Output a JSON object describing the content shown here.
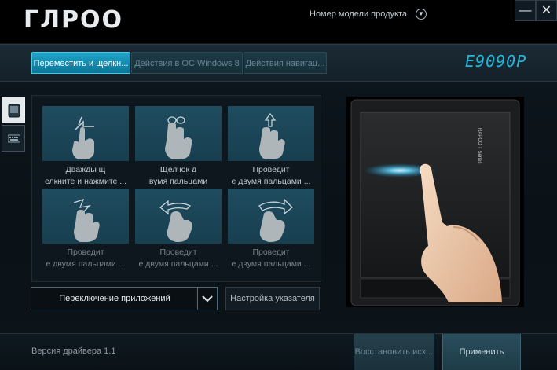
{
  "app": {
    "logo": "ГЛPOO",
    "model_label": "Номер модели продукта",
    "window_buttons": {
      "minimize": "—",
      "close": "✕"
    },
    "product_name": "E9090P"
  },
  "tabs": [
    {
      "label": "Переместить и щелкн...",
      "active": true
    },
    {
      "label": "Действия в ОС Windows 8",
      "active": false
    },
    {
      "label": "Действия навигац...",
      "active": false
    }
  ],
  "side_icons": [
    {
      "icon": "touchpad-icon",
      "active": true
    },
    {
      "icon": "keyboard-icon",
      "active": false
    }
  ],
  "gestures": [
    {
      "line1": "Дважды щ",
      "line2": "елкните и нажмите ...",
      "icon": "double-tap-hold-gesture-icon",
      "enabled": true
    },
    {
      "line1": "Щелчок д",
      "line2": "вумя пальцами",
      "icon": "two-finger-tap-gesture-icon",
      "enabled": true
    },
    {
      "line1": "Проведит",
      "line2": "е двумя пальцами ...",
      "icon": "two-finger-swipe-up-gesture-icon",
      "enabled": true
    },
    {
      "line1": "Проведит",
      "line2": "е двумя пальцами ...",
      "icon": "two-finger-swipe-down-gesture-icon",
      "enabled": false
    },
    {
      "line1": "Проведит",
      "line2": "е двумя пальцами ...",
      "icon": "two-finger-swipe-left-gesture-icon",
      "enabled": false
    },
    {
      "line1": "Проведит",
      "line2": "е двумя пальцами ...",
      "icon": "two-finger-swipe-right-gesture-icon",
      "enabled": false
    }
  ],
  "action_select": {
    "value": "Переключение приложений"
  },
  "pointer_settings": {
    "label": "Настройка указателя"
  },
  "preview": {
    "device_text": "RAPOO T Series"
  },
  "footer": {
    "version": "Версия драйвера 1.1",
    "restore_label": "Восстановить исх...",
    "apply_label": "Применить"
  },
  "colors": {
    "accent": "#1ea4c8",
    "brand": "#22b8de",
    "thumb": "#1f4c5f"
  }
}
